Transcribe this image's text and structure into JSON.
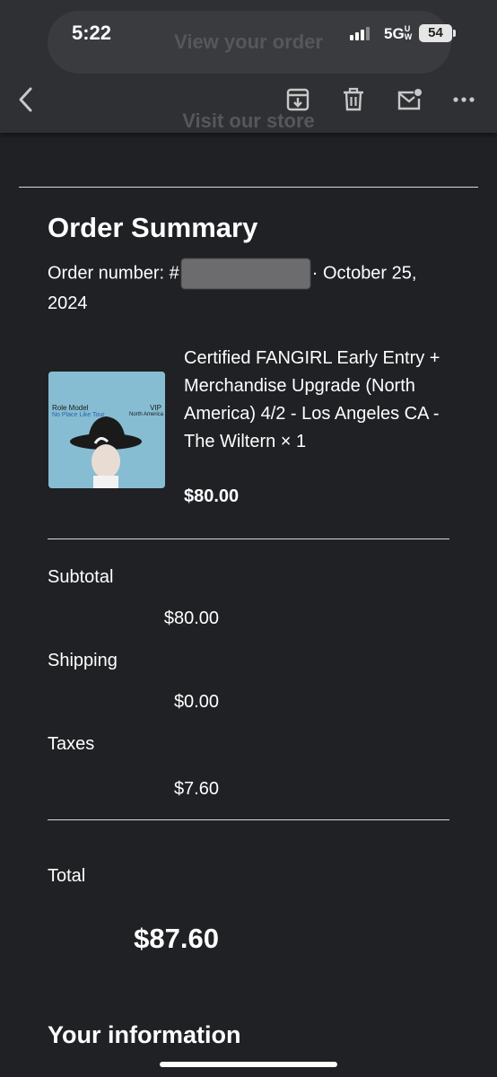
{
  "status_bar": {
    "time": "5:22",
    "network": "5G",
    "network_sup": "UW",
    "battery": "54"
  },
  "background_text": {
    "view_order": "View your order",
    "visit_store": "Visit our store"
  },
  "toolbar": {
    "icons": [
      "back-arrow-icon",
      "archive-icon",
      "trash-icon",
      "mark-unread-icon",
      "more-icon"
    ]
  },
  "order": {
    "heading": "Order Summary",
    "number_prefix": "Order number: #",
    "date_suffix": "· October 25, 2024"
  },
  "item": {
    "thumb_text_left": "Role Model",
    "thumb_text_sub": "No Place Like Tour",
    "thumb_text_right": "VIP",
    "thumb_text_right_sub": "North America",
    "title": "Certified FANGIRL Early Entry + Merchandise Upgrade (North America) 4/2 - Los Angeles CA - The Wiltern × 1",
    "price": "$80.00"
  },
  "summary": {
    "subtotal_label": "Subtotal",
    "subtotal_value": "$80.00",
    "shipping_label": "Shipping",
    "shipping_value": "$0.00",
    "taxes_label": "Taxes",
    "taxes_value": "$7.60",
    "total_label": "Total",
    "total_value": "$87.60"
  },
  "next_section": {
    "heading": "Your information"
  },
  "colors": {
    "background": "#202124",
    "toolbar": "#2f3033",
    "text": "#ffffff",
    "divider": "#d9d9d9"
  }
}
